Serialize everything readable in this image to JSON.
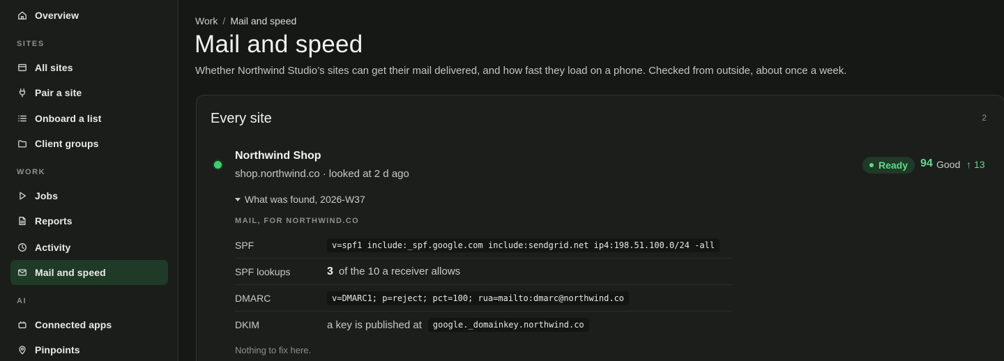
{
  "sidebar": {
    "overview": "Overview",
    "sections": {
      "sites": "SITES",
      "work": "WORK",
      "ai": "AI"
    },
    "items": {
      "all_sites": "All sites",
      "pair_site": "Pair a site",
      "onboard_list": "Onboard a list",
      "client_groups": "Client groups",
      "jobs": "Jobs",
      "reports": "Reports",
      "activity": "Activity",
      "mail_speed": "Mail and speed",
      "connected_apps": "Connected apps",
      "pinpoints": "Pinpoints"
    },
    "active_item": "mail_speed"
  },
  "breadcrumb": {
    "parent": "Work",
    "separator": "/",
    "current": "Mail and speed"
  },
  "page": {
    "title": "Mail and speed",
    "description": "Whether Northwind Studio’s sites can get their mail delivered, and how fast they load on a phone. Checked from outside, about once a week."
  },
  "card": {
    "title": "Every site",
    "count": "2",
    "site": {
      "name": "Northwind Shop",
      "domain": "shop.northwind.co",
      "meta_sep": "·",
      "checked": "looked at 2 d ago",
      "status": "Ready",
      "score": "94",
      "score_label": "Good",
      "delta_arrow": "↑",
      "delta": "13",
      "found_toggle": "What was found, 2026-W37",
      "mail_header": "MAIL, FOR NORTHWIND.CO",
      "rows": {
        "spf_label": "SPF",
        "spf_value": "v=spf1 include:_spf.google.com include:sendgrid.net ip4:198.51.100.0/24 -all",
        "lookups_label": "SPF lookups",
        "lookups_num": "3",
        "lookups_text": "of the 10 a receiver allows",
        "dmarc_label": "DMARC",
        "dmarc_value": "v=DMARC1; p=reject; pct=100; rua=mailto:dmarc@northwind.co",
        "dkim_label": "DKIM",
        "dkim_text": "a key is published at",
        "dkim_value": "google._domainkey.northwind.co"
      },
      "nothing": "Nothing to fix here."
    }
  },
  "colors": {
    "accent_green": "#5fd98a",
    "dot_green": "#3ccf6e",
    "active_bg": "#1f3a26",
    "background": "#161816"
  }
}
